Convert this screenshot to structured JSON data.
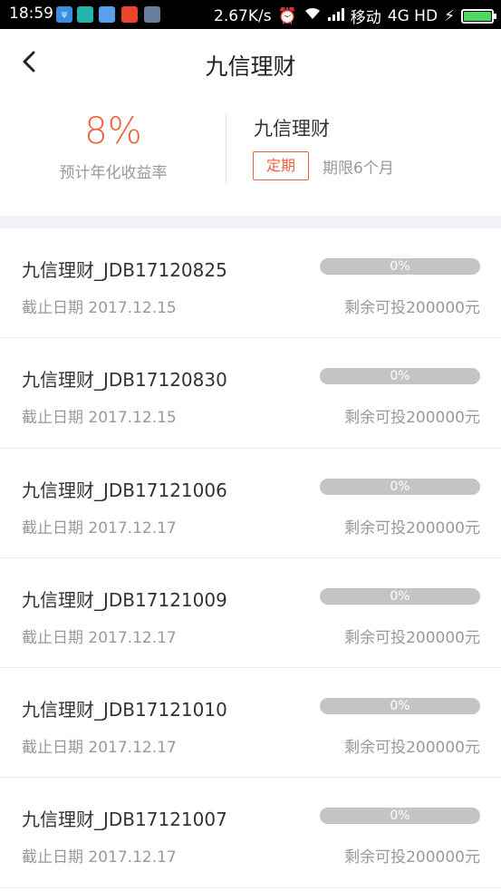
{
  "status_bar": {
    "time": "18:59",
    "speed": "2.67K/s",
    "carrier": "移动",
    "network": "4G HD",
    "notif_icons": [
      {
        "icon": "usb-icon",
        "color": "#3b8fe0"
      },
      {
        "icon": "app-icon",
        "color": "#22b4a8"
      },
      {
        "icon": "app-icon",
        "color": "#5aa0e8"
      },
      {
        "icon": "app-icon",
        "color": "#e8452c"
      },
      {
        "icon": "app-icon",
        "color": "#6a7fa0"
      }
    ]
  },
  "header": {
    "title": "九信理财"
  },
  "summary": {
    "rate": "8%",
    "rate_label": "预计年化收益率",
    "product_name": "九信理财",
    "tag": "定期",
    "term": "期限6个月"
  },
  "items": [
    {
      "name": "九信理财_JDB17120825",
      "deadline": "截止日期 2017.12.15",
      "progress_text": "0%",
      "progress": 0,
      "remain": "剩余可投200000元"
    },
    {
      "name": "九信理财_JDB17120830",
      "deadline": "截止日期 2017.12.15",
      "progress_text": "0%",
      "progress": 0,
      "remain": "剩余可投200000元"
    },
    {
      "name": "九信理财_JDB17121006",
      "deadline": "截止日期 2017.12.17",
      "progress_text": "0%",
      "progress": 0,
      "remain": "剩余可投200000元"
    },
    {
      "name": "九信理财_JDB17121009",
      "deadline": "截止日期 2017.12.17",
      "progress_text": "0%",
      "progress": 0,
      "remain": "剩余可投200000元"
    },
    {
      "name": "九信理财_JDB17121010",
      "deadline": "截止日期 2017.12.17",
      "progress_text": "0%",
      "progress": 0,
      "remain": "剩余可投200000元"
    },
    {
      "name": "九信理财_JDB17121007",
      "deadline": "截止日期 2017.12.17",
      "progress_text": "0%",
      "progress": 0,
      "remain": "剩余可投200000元"
    }
  ],
  "colors": {
    "accent": "#f0603c",
    "progress_track": "#c4c4c4",
    "muted_text": "#999999"
  }
}
